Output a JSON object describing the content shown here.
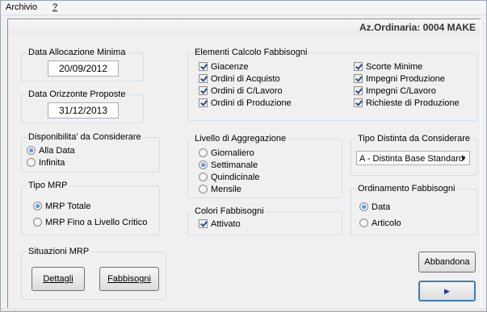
{
  "menu": {
    "file_label": "Archivio",
    "help_label": "?"
  },
  "header": {
    "company_label": "Az.Ordinaria: 0004 MAKE"
  },
  "data_allocazione": {
    "title": "Data Allocazione Minima",
    "value": "20/09/2012"
  },
  "data_orizzonte": {
    "title": "Data Orizzonte Proposte",
    "value": "31/12/2013"
  },
  "disponibilita": {
    "title": "Disponibilita' da Considerare",
    "options": [
      "Alla Data",
      "Infinita"
    ],
    "selected": "Alla Data"
  },
  "tipo_mrp": {
    "title": "Tipo MRP",
    "options": [
      "MRP Totale",
      "MRP Fino a Livello Critico"
    ],
    "selected": "MRP Totale"
  },
  "elementi": {
    "title": "Elementi Calcolo Fabbisogni",
    "items": [
      "Giacenze",
      "Ordini di Acquisto",
      "Ordini di C/Lavoro",
      "Ordini di Produzione",
      "Scorte Minime",
      "Impegni Produzione",
      "Impegni C/Lavoro",
      "Richieste di Produzione"
    ]
  },
  "livello": {
    "title": "Livello di Aggregazione",
    "options": [
      "Giornaliero",
      "Settimanale",
      "Quindicinale",
      "Mensile"
    ],
    "selected": "Settimanale"
  },
  "colori": {
    "title": "Colori Fabbisogni",
    "item": "Attivato"
  },
  "tipo_distinta": {
    "title": "Tipo Distinta da Considerare",
    "value": "A - Distinta Base Standard"
  },
  "ordinamento": {
    "title": "Ordinamento Fabbisogni",
    "options": [
      "Data",
      "Articolo"
    ],
    "selected": "Data"
  },
  "situazioni": {
    "title": "Situazioni MRP",
    "dettagli_label": "Dettagli",
    "fabbisogni_label": "Fabbisogni"
  },
  "actions": {
    "abbandona_label": "Abbandona",
    "run_icon": "play-icon"
  }
}
